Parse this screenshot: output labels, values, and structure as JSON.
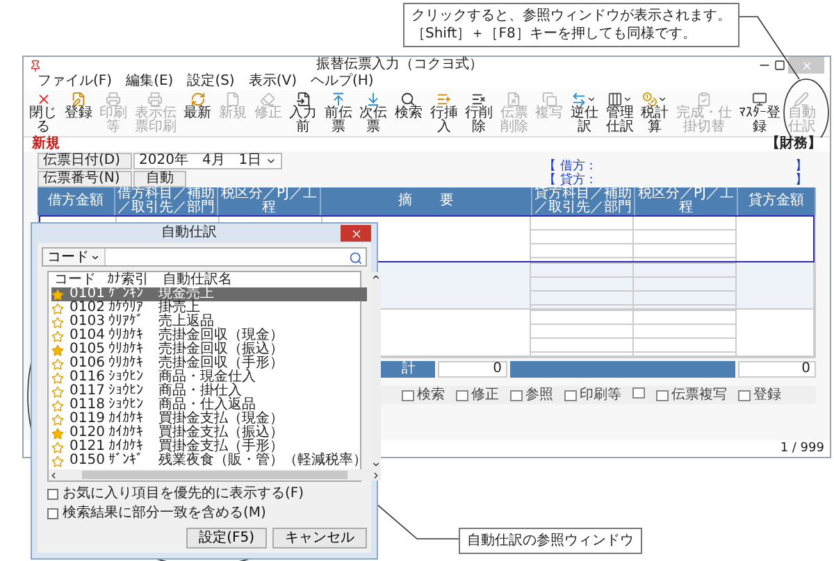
{
  "top_callout": {
    "lines": [
      "クリックすると、参照ウィンドウが表示されます。",
      "［Shift］＋［F8］キーを押しても同様です。"
    ]
  },
  "window": {
    "title": "振替伝票入力（コクヨ式）"
  },
  "menu": [
    "ファイル(F)",
    "編集(E)",
    "設定(S)",
    "表示(V)",
    "ヘルプ(H)"
  ],
  "toolbar": [
    {
      "label": "閉じる",
      "disabled": false,
      "dropdown": false
    },
    {
      "label": "登録",
      "disabled": false,
      "dropdown": false
    },
    {
      "label": "印刷等",
      "disabled": true,
      "dropdown": false
    },
    {
      "label": "表示伝票印刷",
      "disabled": true,
      "dropdown": false
    },
    {
      "label": "最新",
      "disabled": false,
      "dropdown": false
    },
    {
      "label": "新規",
      "disabled": true,
      "dropdown": false
    },
    {
      "label": "修正",
      "disabled": true,
      "dropdown": false
    },
    {
      "label": "入力前",
      "disabled": false,
      "dropdown": false
    },
    {
      "label": "前伝票",
      "disabled": false,
      "dropdown": false
    },
    {
      "label": "次伝票",
      "disabled": false,
      "dropdown": false
    },
    {
      "label": "検索",
      "disabled": false,
      "dropdown": false
    },
    {
      "label": "行挿入",
      "disabled": false,
      "dropdown": false
    },
    {
      "label": "行削除",
      "disabled": false,
      "dropdown": false
    },
    {
      "label": "伝票削除",
      "disabled": true,
      "dropdown": false
    },
    {
      "label": "複写",
      "disabled": true,
      "dropdown": false
    },
    {
      "label": "逆仕訳",
      "disabled": false,
      "dropdown": true
    },
    {
      "label": "管理仕訳",
      "disabled": false,
      "dropdown": true
    },
    {
      "label": "税計算",
      "disabled": false,
      "dropdown": true
    },
    {
      "label": "完成・仕掛切替",
      "disabled": true,
      "dropdown": false
    },
    {
      "label": "ﾏｽﾀｰ登録",
      "disabled": false,
      "dropdown": false
    },
    {
      "label": "自動仕訳",
      "disabled": true,
      "dropdown": false
    }
  ],
  "mode": "新規",
  "division": "【財務】",
  "form": {
    "date_label": "伝票日付(D)",
    "date_value": "2020年　4月　1日",
    "number_label": "伝票番号(N)",
    "number_value": "自動"
  },
  "balance": [
    {
      "open": "【",
      "label": "借方 :",
      "close": "】"
    },
    {
      "open": "【",
      "label": "貸方 :",
      "close": "】"
    }
  ],
  "table": {
    "columns": [
      "借方金額",
      "借方科目／補助／取引先／部門",
      "税区分／PJ／工程",
      "摘　　要",
      "貸方科目／補助／取引先／部門",
      "税区分／PJ／工程",
      "貸方金額"
    ],
    "rows": [
      {
        "selected": true
      },
      {
        "selected": false
      },
      {
        "selected": false
      }
    ],
    "totals": {
      "label": "計",
      "debit": "0",
      "credit": "0"
    }
  },
  "function_keys": [
    {
      "kind": "key",
      "label": "検索"
    },
    {
      "kind": "key",
      "label": "修正"
    },
    {
      "kind": "key",
      "label": "参照"
    },
    {
      "kind": "key",
      "label": "印刷等"
    },
    {
      "kind": "blank"
    },
    {
      "kind": "key",
      "label": "伝票複写"
    },
    {
      "kind": "key",
      "label": "登録"
    }
  ],
  "pager": "1 / 999",
  "dialog": {
    "title": "自動仕訳",
    "search_mode": "コード",
    "columns": [
      "コード",
      "ｶﾅ索引",
      "自動仕訳名"
    ],
    "rows": [
      {
        "code": "0101",
        "kana": "ｹﾞﾝｷﾝ",
        "name": "現金売上",
        "favorite": true,
        "selected": true
      },
      {
        "code": "0102",
        "kana": "ｶｹｳﾘｱ",
        "name": "掛売上",
        "favorite": false,
        "selected": false
      },
      {
        "code": "0103",
        "kana": "ｳﾘｱｹﾞ",
        "name": "売上返品",
        "favorite": false,
        "selected": false
      },
      {
        "code": "0104",
        "kana": "ｳﾘｶｹｷ",
        "name": "売掛金回収（現金）",
        "favorite": false,
        "selected": false
      },
      {
        "code": "0105",
        "kana": "ｳﾘｶｹｷ",
        "name": "売掛金回収（振込）",
        "favorite": true,
        "selected": false
      },
      {
        "code": "0106",
        "kana": "ｳﾘｶｹｷ",
        "name": "売掛金回収（手形）",
        "favorite": false,
        "selected": false
      },
      {
        "code": "0116",
        "kana": "ｼｮｳﾋﾝ",
        "name": "商品・現金仕入",
        "favorite": false,
        "selected": false
      },
      {
        "code": "0117",
        "kana": "ｼｮｳﾋﾝ",
        "name": "商品・掛仕入",
        "favorite": false,
        "selected": false
      },
      {
        "code": "0118",
        "kana": "ｼｮｳﾋﾝ",
        "name": "商品・仕入返品",
        "favorite": false,
        "selected": false
      },
      {
        "code": "0119",
        "kana": "ｶｲｶｹｷ",
        "name": "買掛金支払（現金）",
        "favorite": false,
        "selected": false
      },
      {
        "code": "0120",
        "kana": "ｶｲｶｹｷ",
        "name": "買掛金支払（振込）",
        "favorite": true,
        "selected": false
      },
      {
        "code": "0121",
        "kana": "ｶｲｶｹｷ",
        "name": "買掛金支払（手形）",
        "favorite": false,
        "selected": false
      },
      {
        "code": "0150",
        "kana": "ｻﾞﾝｷﾞ",
        "name": "残業夜食（販・管）（軽減税率）",
        "favorite": false,
        "selected": false
      }
    ],
    "options": [
      {
        "label": "お気に入り項目を優先的に表示する(F)",
        "checked": false
      },
      {
        "label": "検索結果に部分一致を含める(M)",
        "checked": false
      }
    ],
    "buttons": [
      "設定(F5)",
      "キャンセル"
    ]
  },
  "bottom_callout": {
    "text": "自動仕訳の参照ウィンドウ"
  }
}
